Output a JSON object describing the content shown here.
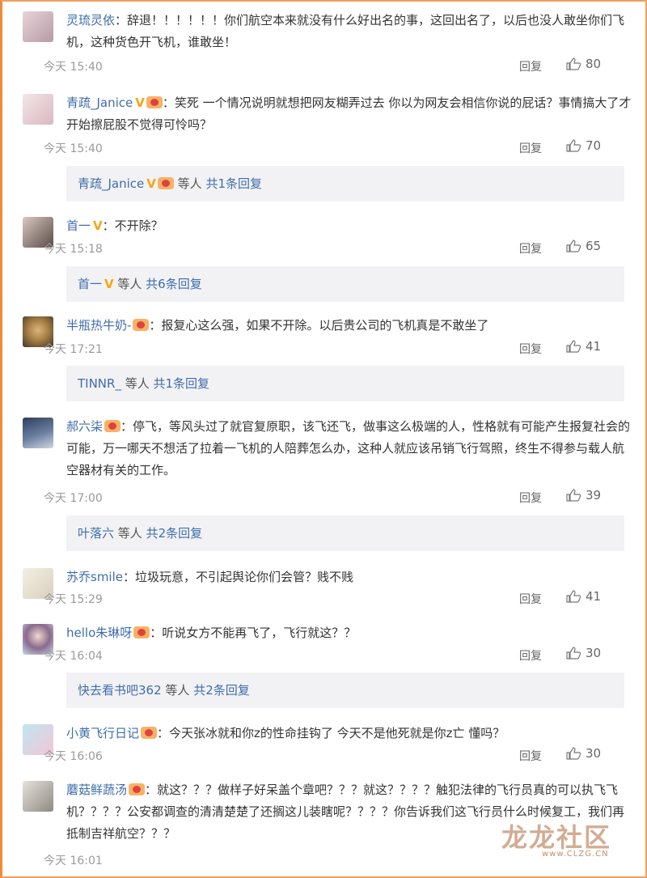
{
  "comments": [
    {
      "user": "灵琉灵依",
      "text": "：辞退！！！！！！你们航空本来就没有什么好出名的事，这回出名了，以后也没人敢坐你们飞机，这种货色开飞机，谁敢坐！",
      "time": "今天 15:40",
      "reply": "回复",
      "likes": "80"
    },
    {
      "user": "青疏_Janice",
      "text": "：笑死 一个情况说明就想把网友糊弄过去 你以为网友会相信你说的屁话？事情搞大了才开始擦屁股不觉得可怜吗？",
      "time": "今天 15:40",
      "reply": "回复",
      "likes": "70",
      "sub": {
        "user": "青疏_Janice",
        "mid": " 等人 ",
        "more": "共1条回复"
      }
    },
    {
      "user": "首一",
      "text": "：不开除？",
      "time": "今天 15:18",
      "reply": "回复",
      "likes": "65",
      "sub": {
        "user": "首一",
        "mid": " 等人 ",
        "more": "共6条回复"
      }
    },
    {
      "user": "半瓶热牛奶-",
      "text": "：报复心这么强，如果不开除。以后贵公司的飞机真是不敢坐了",
      "time": "今天 17:21",
      "reply": "回复",
      "likes": "41",
      "sub": {
        "user": "TINNR_",
        "mid": " 等人 ",
        "more": "共1条回复"
      }
    },
    {
      "user": "郝六柒",
      "text": "：停飞，等风头过了就官复原职，该飞还飞，做事这么极端的人，性格就有可能产生报复社会的可能，万一哪天不想活了拉着一飞机的人陪葬怎么办，这种人就应该吊销飞行驾照，终生不得参与载人航空器材有关的工作。",
      "time": "今天 17:00",
      "reply": "回复",
      "likes": "39",
      "sub": {
        "user": "叶落六",
        "mid": " 等人 ",
        "more": "共2条回复"
      }
    },
    {
      "user": "苏乔smile",
      "text": "：垃圾玩意，不引起舆论你们会管？贱不贱",
      "time": "今天 15:29",
      "reply": "回复",
      "likes": "41"
    },
    {
      "user": "hello朱琳呀",
      "text": "：听说女方不能再飞了，飞行就这？？",
      "time": "今天 16:04",
      "reply": "回复",
      "likes": "30",
      "sub": {
        "user": "快去看书吧362",
        "mid": " 等人 ",
        "more": "共2条回复"
      }
    },
    {
      "user": "小黄飞行日记",
      "text": "：今天张冰就和你𝗓的性命挂钩了 今天不是他死就是你𝗓亡 懂吗？",
      "time": "今天 16:06",
      "reply": "回复",
      "likes": "30"
    },
    {
      "user": "蘑菇鲜蔬汤",
      "text": "：就这？？？做样子好呆盖个章吧？？？就这？？？？触犯法律的飞行员真的可以执飞飞机？？？？公安都调查的清清楚楚了还搁这儿装瞎呢？？？？你告诉我们这飞行员什么时候复工，我们再抵制吉祥航空？？？",
      "time": "今天 16:01",
      "reply": "",
      "likes": ""
    }
  ],
  "watermark": {
    "text": "龙龙社区",
    "url": "www.CLZG.CN"
  },
  "colors": {
    "link": "#3f6dab",
    "meta": "#9a9a9a",
    "subbg": "#f2f2f5"
  }
}
